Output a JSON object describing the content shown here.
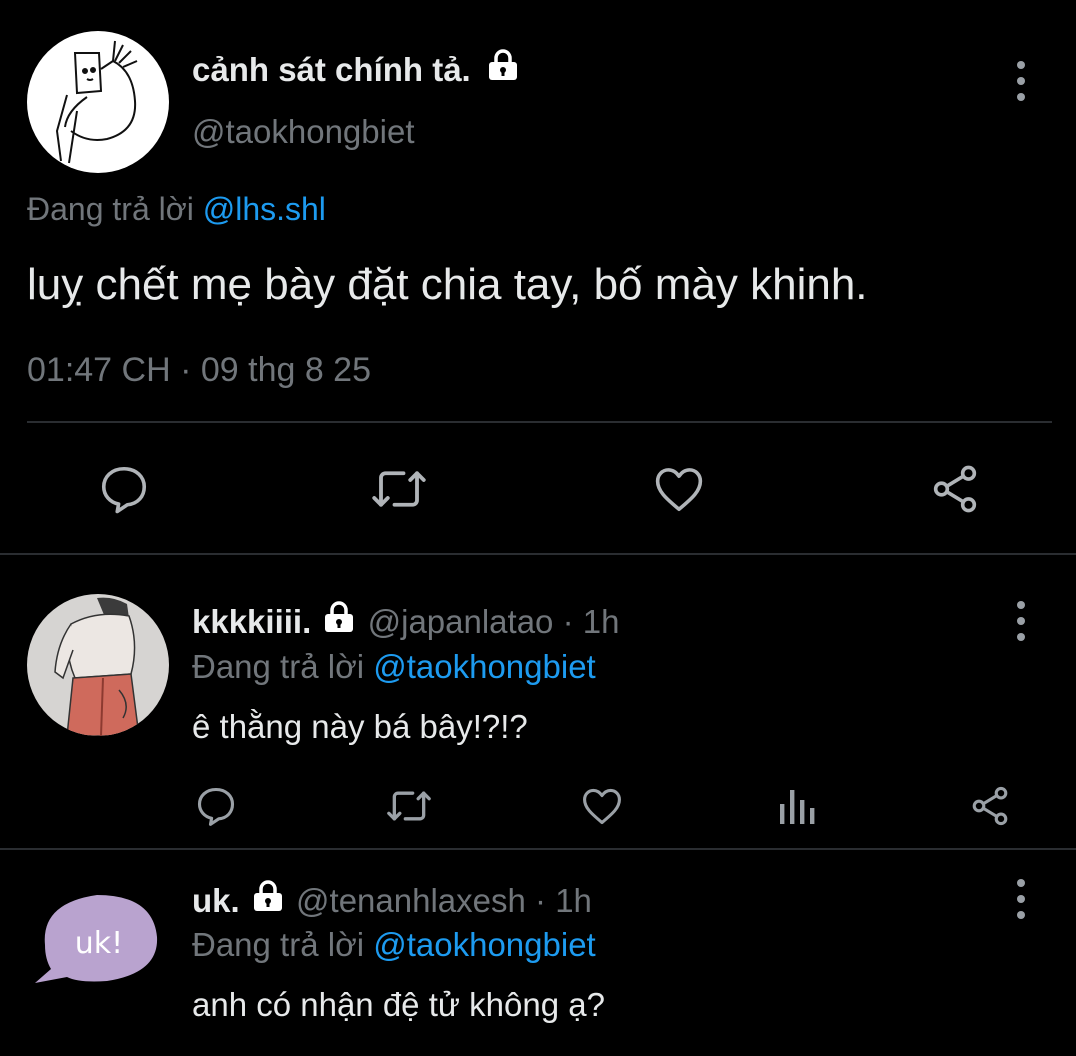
{
  "main_tweet": {
    "display_name": "cảnh sát chính tả.",
    "handle": "@taokhongbiet",
    "replying_prefix": "Đang trả lời",
    "replying_to": "@lhs.shl",
    "text": "luỵ chết mẹ bày đặt chia tay, bố mày khinh.",
    "timestamp": "01:47 CH · 09 thg 8 25"
  },
  "replies": [
    {
      "display_name": "kkkkiiii.",
      "handle": "@japanlatao",
      "time": "· 1h",
      "replying_prefix": "Đang trả lời",
      "replying_to": "@taokhongbiet",
      "text": "ê thằng này bá bây!?!?"
    },
    {
      "display_name": "uk.",
      "handle": "@tenanhlaxesh",
      "time": "· 1h",
      "replying_prefix": "Đang trả lời",
      "replying_to": "@taokhongbiet",
      "text": "anh có nhận đệ tử không ạ?",
      "avatar_text": "uk!"
    }
  ],
  "icons": {
    "reply": "reply-icon",
    "retweet": "retweet-icon",
    "like": "heart-icon",
    "share": "share-icon",
    "views": "views-icon",
    "more": "more-icon",
    "lock": "lock-icon"
  },
  "colors": {
    "background": "#000000",
    "text": "#e7e9ea",
    "muted": "#71767b",
    "link": "#1d9bf0",
    "divider": "#2a2d31"
  }
}
